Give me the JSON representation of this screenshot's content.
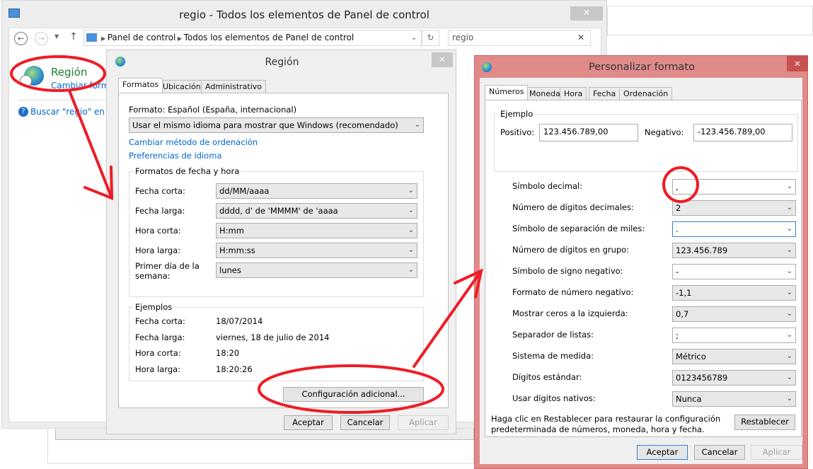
{
  "control_panel": {
    "title": "regio - Todos los elementos de Panel de control",
    "breadcrumb": [
      "Panel de control",
      "Todos los elementos de Panel de control"
    ],
    "search_value": "regio",
    "item_title": "Región",
    "item_link": "Cambiar forma",
    "help_link": "Buscar \"regio\" en Ay"
  },
  "region": {
    "title": "Región",
    "tabs": [
      "Formatos",
      "Ubicación",
      "Administrativo"
    ],
    "format_label": "Formato: Español (España, internacional)",
    "format_value": "Usar el mismo idioma para mostrar que Windows (recomendado)",
    "link_sort": "Cambiar método de ordenación",
    "link_lang": "Preferencias de idioma",
    "datetime_group": "Formatos de fecha y hora",
    "datetime": [
      {
        "label": "Fecha corta:",
        "value": "dd/MM/aaaa"
      },
      {
        "label": "Fecha larga:",
        "value": "dddd, d' de 'MMMM' de 'aaaa"
      },
      {
        "label": "Hora corta:",
        "value": "H:mm"
      },
      {
        "label": "Hora larga:",
        "value": "H:mm:ss"
      },
      {
        "label": "Primer día de la semana:",
        "value": "lunes"
      }
    ],
    "examples_group": "Ejemplos",
    "examples": [
      {
        "label": "Fecha corta:",
        "value": "18/07/2014"
      },
      {
        "label": "Fecha larga:",
        "value": "viernes, 18 de julio de 2014"
      },
      {
        "label": "Hora corta:",
        "value": "18:20"
      },
      {
        "label": "Hora larga:",
        "value": "18:20:26"
      }
    ],
    "additional": "Configuración adicional...",
    "ok": "Aceptar",
    "cancel": "Cancelar",
    "apply": "Aplicar"
  },
  "custom": {
    "title": "Personalizar formato",
    "tabs": [
      "Números",
      "Moneda",
      "Hora",
      "Fecha",
      "Ordenación"
    ],
    "example_group": "Ejemplo",
    "positive_label": "Positivo:",
    "positive_value": "123.456.789,00",
    "negative_label": "Negativo:",
    "negative_value": "-123.456.789,00",
    "rows": [
      {
        "label": "Símbolo decimal:",
        "value": ","
      },
      {
        "label": "Número de dígitos decimales:",
        "value": "2"
      },
      {
        "label": "Símbolo de separación de miles:",
        "value": "."
      },
      {
        "label": "Número de dígitos en grupo:",
        "value": "123.456.789"
      },
      {
        "label": "Símbolo de signo negativo:",
        "value": "-"
      },
      {
        "label": "Formato de número negativo:",
        "value": "-1,1"
      },
      {
        "label": "Mostrar ceros a la izquierda:",
        "value": "0,7"
      },
      {
        "label": "Separador de listas:",
        "value": ";"
      },
      {
        "label": "Sistema de medida:",
        "value": "Métrico"
      },
      {
        "label": "Dígitos estándar:",
        "value": "0123456789"
      },
      {
        "label": "Usar dígitos nativos:",
        "value": "Nunca"
      }
    ],
    "reset_help": [
      "Haga clic en Restablecer para restaurar la configuración",
      "predeterminada de números, moneda, hora y fecha."
    ],
    "reset": "Restablecer",
    "ok": "Aceptar",
    "cancel": "Cancelar",
    "apply": "Aplicar",
    "accent": "#e08a8a"
  },
  "annotation_color": "#ee1c25"
}
